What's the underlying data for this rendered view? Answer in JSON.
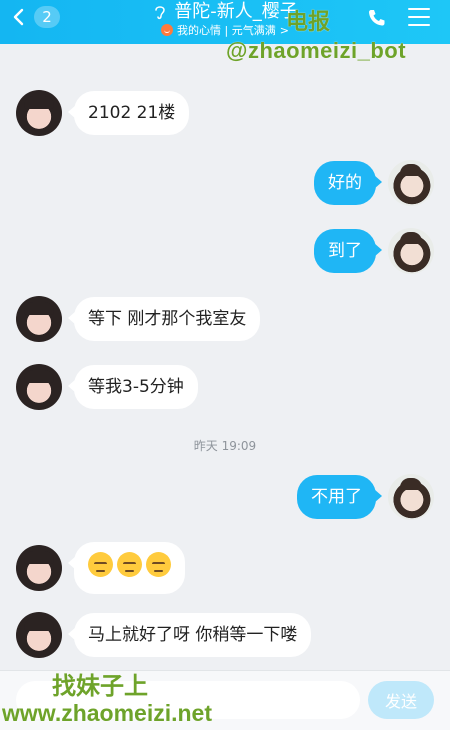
{
  "header": {
    "back_badge": "2",
    "title": "普陀-新人_樱子",
    "subtitle": "我的心情 | 元气满满",
    "subtitle_chevron": ">",
    "icons": [
      "back-chevron-icon",
      "ear-icon",
      "mood-icon",
      "phone-icon",
      "menu-icon"
    ],
    "bg_color": "#14b6f2"
  },
  "messages": [
    {
      "side": "left",
      "avatar": "girl-avatar",
      "text": "2102  21楼"
    },
    {
      "side": "right",
      "avatar": "woman-avatar",
      "text": "好的"
    },
    {
      "side": "right",
      "avatar": "woman-avatar",
      "text": "到了"
    },
    {
      "side": "left",
      "avatar": "girl-avatar",
      "text": "等下  刚才那个我室友"
    },
    {
      "side": "left",
      "avatar": "girl-avatar",
      "text": "等我3-5分钟"
    },
    {
      "side": "right",
      "avatar": "woman-avatar",
      "text": "不用了"
    },
    {
      "side": "left",
      "avatar": "girl-avatar",
      "text": "",
      "emoji": [
        "pensive-emoji",
        "pensive-emoji",
        "pensive-emoji"
      ]
    },
    {
      "side": "left",
      "avatar": "girl-avatar",
      "text": "马上就好了呀 你稍等一下喽"
    }
  ],
  "timestamp": "昨天 19:09",
  "input": {
    "value": "",
    "placeholder": "",
    "send_label": "发送"
  },
  "watermarks": {
    "line1": "电报",
    "line2": "@zhaomeizi_bot",
    "line3": "找妹子上",
    "line4": "www.zhaomeizi.net",
    "color": "#6ea32a"
  },
  "colors": {
    "outgoing_bubble": "#1fb6f5",
    "incoming_bubble": "#ffffff",
    "chat_bg": "#eef0f3",
    "send_button": "#bfe8fa"
  }
}
